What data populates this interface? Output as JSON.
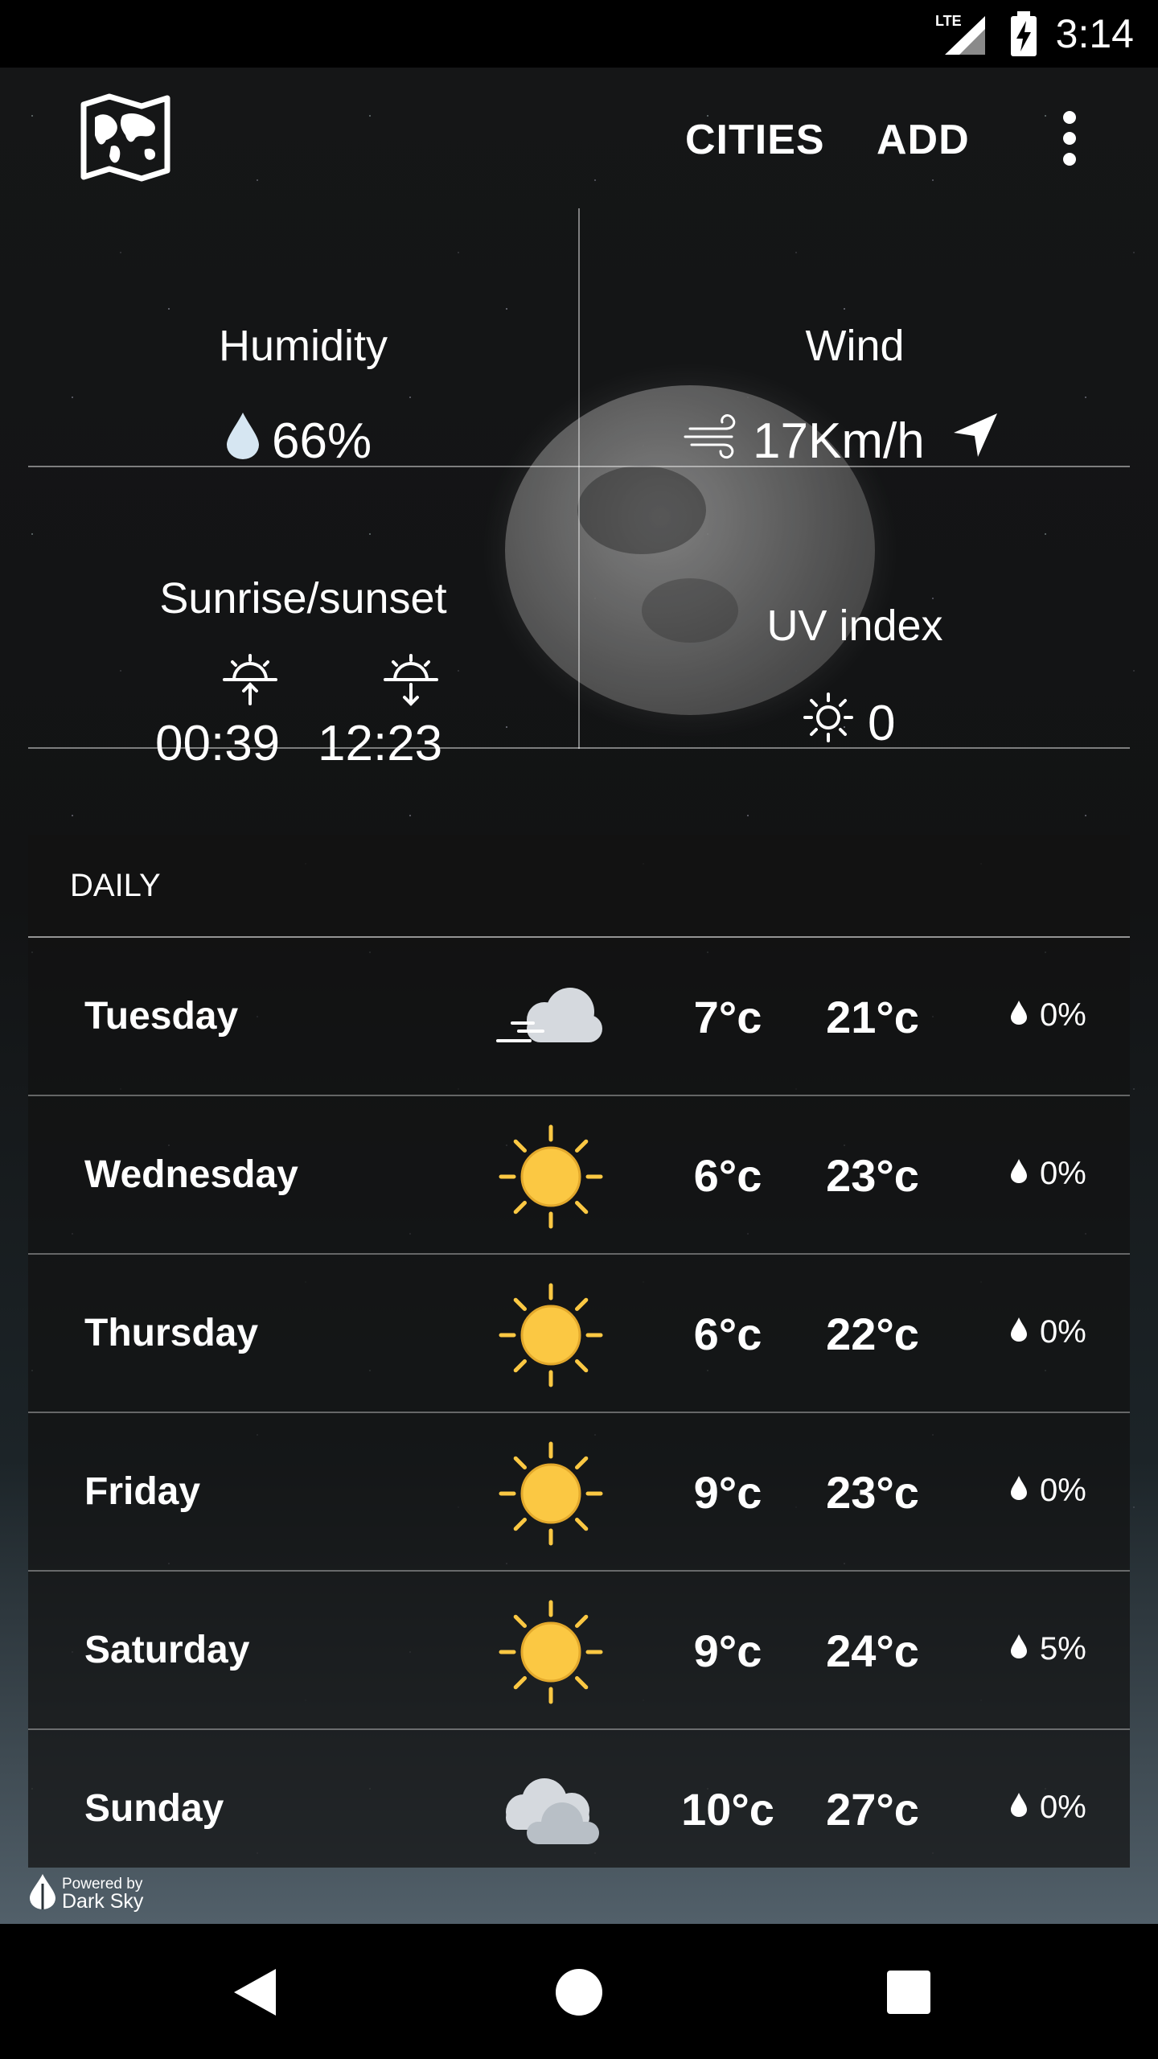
{
  "status_bar": {
    "network": "LTE",
    "time": "3:14"
  },
  "app_bar": {
    "logo_icon": "world-map-icon",
    "cities_label": "CITIES",
    "add_label": "ADD",
    "menu_icon": "more-vert-icon"
  },
  "details": {
    "humidity": {
      "title": "Humidity",
      "value": "66%"
    },
    "wind": {
      "title": "Wind",
      "value": "17Km/h"
    },
    "sun": {
      "title": "Sunrise/sunset",
      "sunrise": "00:39",
      "sunset": "12:23"
    },
    "uv": {
      "title": "UV index",
      "value": "0"
    }
  },
  "daily": {
    "header": "DAILY",
    "days": [
      {
        "name": "Tuesday",
        "icon": "wind-cloud-icon",
        "low": "7°c",
        "high": "21°c",
        "precip": "0%"
      },
      {
        "name": "Wednesday",
        "icon": "sun-icon",
        "low": "6°c",
        "high": "23°c",
        "precip": "0%"
      },
      {
        "name": "Thursday",
        "icon": "sun-icon",
        "low": "6°c",
        "high": "22°c",
        "precip": "0%"
      },
      {
        "name": "Friday",
        "icon": "sun-icon",
        "low": "9°c",
        "high": "23°c",
        "precip": "0%"
      },
      {
        "name": "Saturday",
        "icon": "sun-icon",
        "low": "9°c",
        "high": "24°c",
        "precip": "5%"
      },
      {
        "name": "Sunday",
        "icon": "cloud-icon",
        "low": "10°c",
        "high": "27°c",
        "precip": "0%"
      }
    ]
  },
  "footer": {
    "powered_by": "Powered by",
    "brand": "Dark Sky"
  },
  "colors": {
    "sun": "#FBC843",
    "cloud": "#D5D9DE",
    "text": "#FFFFFF"
  }
}
